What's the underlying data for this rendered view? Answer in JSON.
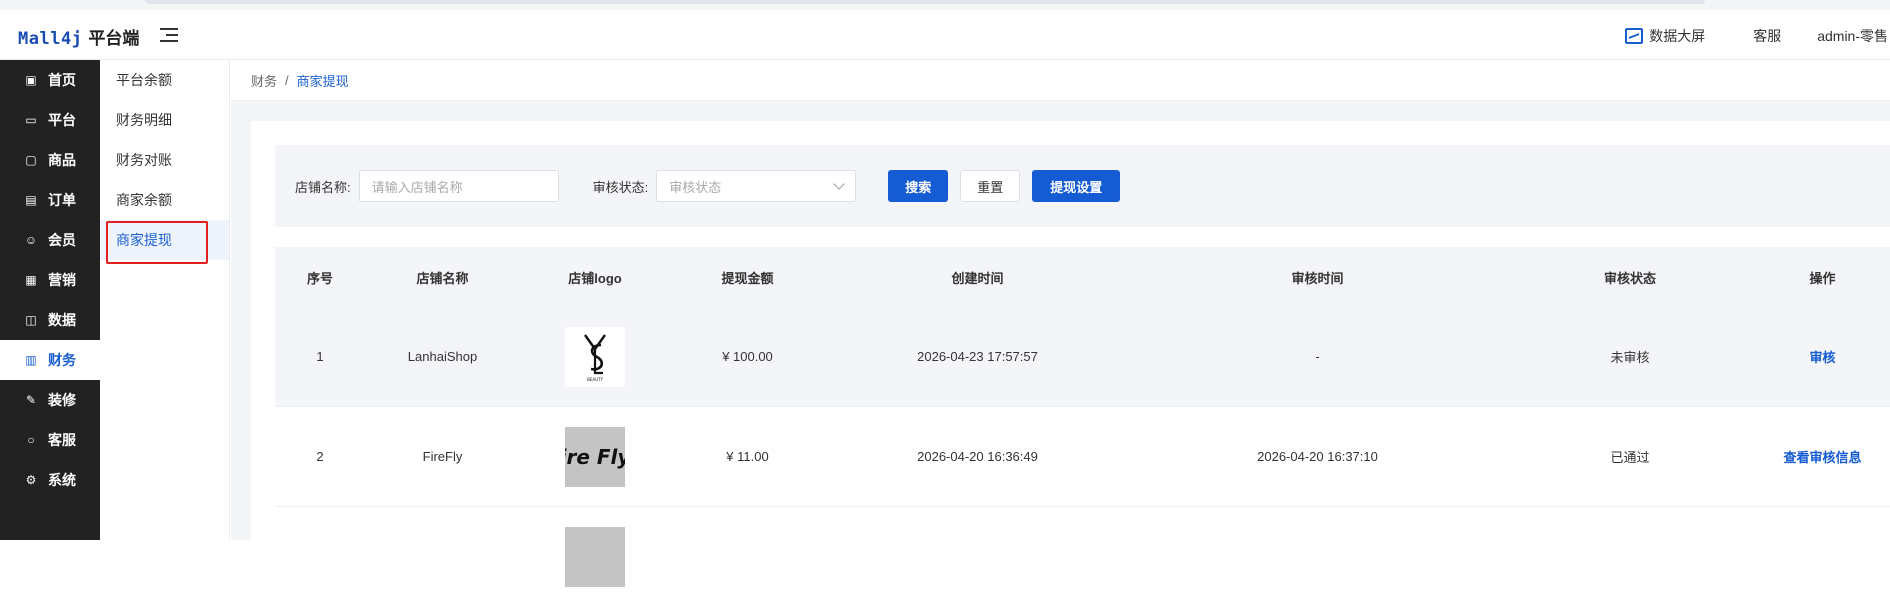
{
  "header": {
    "brand": "Mall4j",
    "brand_suffix": "平台端",
    "data_screen": "数据大屏",
    "service": "客服",
    "user": "admin-零售"
  },
  "sidebar": {
    "items": [
      {
        "label": "首页",
        "icon": "home-icon"
      },
      {
        "label": "平台",
        "icon": "platform-icon"
      },
      {
        "label": "商品",
        "icon": "product-icon"
      },
      {
        "label": "订单",
        "icon": "order-icon"
      },
      {
        "label": "会员",
        "icon": "member-icon"
      },
      {
        "label": "营销",
        "icon": "gift-icon"
      },
      {
        "label": "数据",
        "icon": "data-icon"
      },
      {
        "label": "财务",
        "icon": "finance-icon",
        "active": true
      },
      {
        "label": "装修",
        "icon": "decorate-icon"
      },
      {
        "label": "客服",
        "icon": "chat-icon"
      },
      {
        "label": "系统",
        "icon": "settings-icon"
      }
    ]
  },
  "submenu": {
    "items": [
      {
        "label": "平台余额"
      },
      {
        "label": "财务明细"
      },
      {
        "label": "财务对账"
      },
      {
        "label": "商家余额"
      },
      {
        "label": "商家提现",
        "active": true
      }
    ]
  },
  "breadcrumb": {
    "parent": "财务",
    "separator": "/",
    "current": "商家提现"
  },
  "search": {
    "shop_label": "店铺名称:",
    "shop_placeholder": "请输入店铺名称",
    "status_label": "审核状态:",
    "status_placeholder": "审核状态",
    "search_btn": "搜索",
    "reset_btn": "重置",
    "settings_btn": "提现设置"
  },
  "table": {
    "headers": [
      "序号",
      "店铺名称",
      "店铺logo",
      "提现金额",
      "创建时间",
      "审核时间",
      "审核状态",
      "操作"
    ],
    "rows": [
      {
        "index": "1",
        "shop": "LanhaiShop",
        "logo_text": "YSL",
        "amount": "¥ 100.00",
        "created": "2026-04-23 17:57:57",
        "audited": "-",
        "status": "未审核",
        "action": "审核"
      },
      {
        "index": "2",
        "shop": "FireFly",
        "logo_text": "ire Fly",
        "amount": "¥ 11.00",
        "created": "2026-04-20 16:36:49",
        "audited": "2026-04-20 16:37:10",
        "status": "已通过",
        "action": "查看审核信息"
      }
    ]
  },
  "colors": {
    "accent": "#155bd4",
    "sidebar_bg": "#222222",
    "highlight_border": "#e02020"
  }
}
